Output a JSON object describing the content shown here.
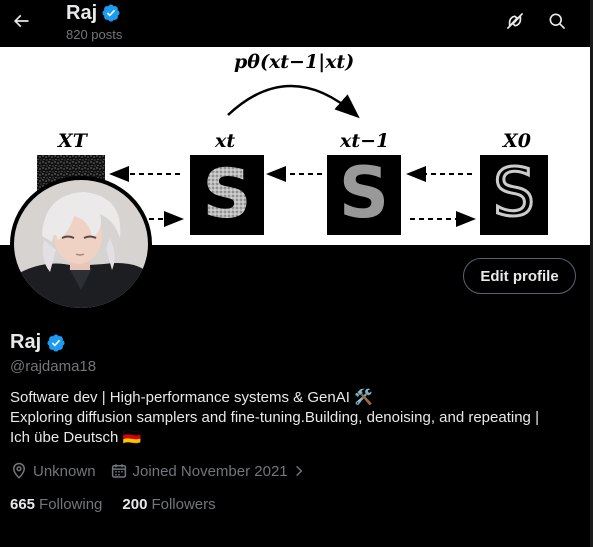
{
  "header": {
    "name": "Raj",
    "posts_count": "820 posts"
  },
  "banner": {
    "formula": "pθ(xt−1|xt)",
    "labels": [
      "XT",
      "xt",
      "xt−1",
      "X0"
    ],
    "sample_letter": "S"
  },
  "profile": {
    "edit_label": "Edit profile",
    "name": "Raj",
    "handle": "@rajdama18",
    "bio": [
      "Software dev | High-performance systems & GenAI 🛠️",
      "Exploring diffusion samplers and fine-tuning.Building, denoising, and repeating |",
      "Ich übe Deutsch 🇩🇪"
    ],
    "location": "Unknown",
    "joined": "Joined November 2021",
    "following_count": "665",
    "following_label": "Following",
    "followers_count": "200",
    "followers_label": "Followers"
  },
  "colors": {
    "background": "#000000",
    "text_primary": "#e7e9ea",
    "text_secondary": "#71767b",
    "verified_blue": "#1d9bf0",
    "button_border": "#536471"
  },
  "icons": [
    "back-arrow-icon",
    "verified-badge-icon",
    "grok-icon",
    "search-icon",
    "location-icon",
    "calendar-icon",
    "chevron-right-icon"
  ]
}
